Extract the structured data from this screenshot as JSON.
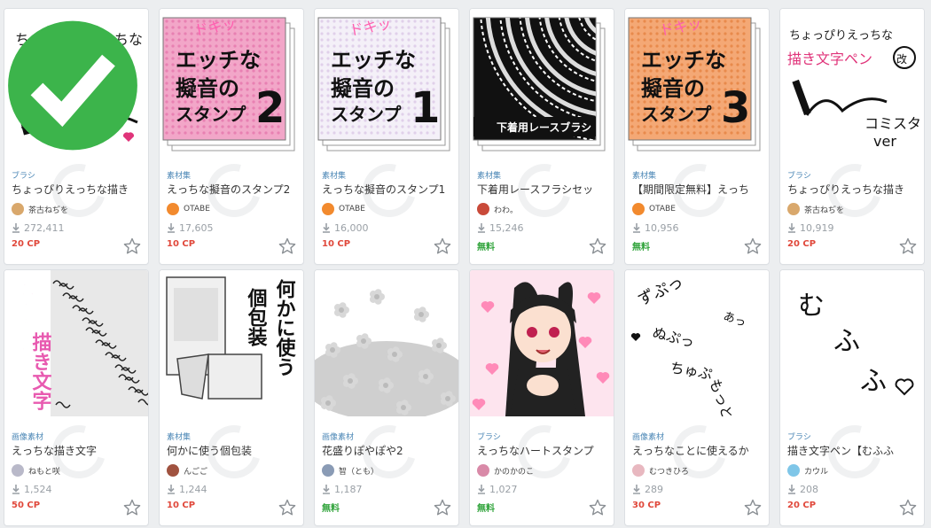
{
  "colors": {
    "background": "#eceef0",
    "category": "#4a86b5",
    "price_cp": "#e0483b",
    "price_free": "#2fa33a",
    "pink": "#f2a6c8",
    "orange": "#f4a875"
  },
  "icons": {
    "download": "download-icon",
    "favorite": "star-outline-icon",
    "checked": "check-circle-icon"
  },
  "cards": [
    {
      "category": "ブラシ",
      "title": "ちょっぴりえっちな描き",
      "author": "茶古ねぢを",
      "downloads": "272,411",
      "price": "20 CP",
      "price_type": "cp",
      "thumb_lines": [
        "ちょっぴりえっちな",
        "描き文字ペン"
      ],
      "avatar_color": "#d9a86c",
      "checked": true
    },
    {
      "category": "素材集",
      "title": "えっちな擬音のスタンプ2",
      "author": "OTABE",
      "downloads": "17,605",
      "price": "10 CP",
      "price_type": "cp",
      "thumb_lines": [
        "エッチな",
        "擬音の",
        "スタンプ",
        "2",
        "ドキッ"
      ],
      "avatar_color": "#f28a2e"
    },
    {
      "category": "素材集",
      "title": "えっちな擬音のスタンプ1",
      "author": "OTABE",
      "downloads": "16,000",
      "price": "10 CP",
      "price_type": "cp",
      "thumb_lines": [
        "エッチな",
        "擬音の",
        "スタンプ",
        "1",
        "ドキッ"
      ],
      "avatar_color": "#f28a2e"
    },
    {
      "category": "素材集",
      "title": "下着用レースフラシセッ",
      "author": "わわ。",
      "downloads": "15,246",
      "price": "無料",
      "price_type": "free",
      "thumb_lines": [
        "下着用レースブラシ"
      ],
      "avatar_color": "#c94a3a"
    },
    {
      "category": "素材集",
      "title": "【期間限定無料】えっち",
      "author": "OTABE",
      "downloads": "10,956",
      "price": "無料",
      "price_type": "free",
      "thumb_lines": [
        "エッチな",
        "擬音の",
        "スタンプ",
        "3",
        "ドキッ"
      ],
      "avatar_color": "#f28a2e"
    },
    {
      "category": "ブラシ",
      "title": "ちょっぴりえっちな描き",
      "author": "茶古ねぢを",
      "downloads": "10,919",
      "price": "20 CP",
      "price_type": "cp",
      "thumb_lines": [
        "ちょっぴりえっちな",
        "描き文字ペン",
        "改",
        "コミスタ",
        "ver"
      ],
      "avatar_color": "#d9a86c"
    },
    {
      "category": "画像素材",
      "title": "えっちな描き文字",
      "author": "ねもと咲",
      "downloads": "1,524",
      "price": "50 CP",
      "price_type": "cp",
      "thumb_lines": [
        "えっちな",
        "描き文字"
      ],
      "avatar_color": "#b9b9c9"
    },
    {
      "category": "素材集",
      "title": "何かに使う個包装",
      "author": "んごご",
      "downloads": "1,244",
      "price": "10 CP",
      "price_type": "cp",
      "thumb_lines": [
        "何かに使う",
        "個包装"
      ],
      "avatar_color": "#a0523f"
    },
    {
      "category": "画像素材",
      "title": "花盛りぽやぽや2",
      "author": "智（とも）",
      "downloads": "1,187",
      "price": "無料",
      "price_type": "free",
      "thumb_lines": [],
      "avatar_color": "#8a9bb5"
    },
    {
      "category": "ブラシ",
      "title": "えっちなハートスタンプ",
      "author": "かのかのこ",
      "downloads": "1,027",
      "price": "無料",
      "price_type": "free",
      "thumb_lines": [],
      "avatar_color": "#d98aa8"
    },
    {
      "category": "画像素材",
      "title": "えっちなことに使えるか",
      "author": "むつきひろ",
      "downloads": "289",
      "price": "30 CP",
      "price_type": "cp",
      "thumb_lines": [
        "ずぷっ",
        "ぬぷっ",
        "ちゅぷ",
        "あっ",
        "もっと"
      ],
      "avatar_color": "#e8b8c0"
    },
    {
      "category": "ブラシ",
      "title": "描き文字ペン【むふふ",
      "author": "カウル",
      "downloads": "208",
      "price": "20 CP",
      "price_type": "cp",
      "thumb_lines": [
        "むふふ"
      ],
      "avatar_color": "#7fc6e8"
    }
  ]
}
